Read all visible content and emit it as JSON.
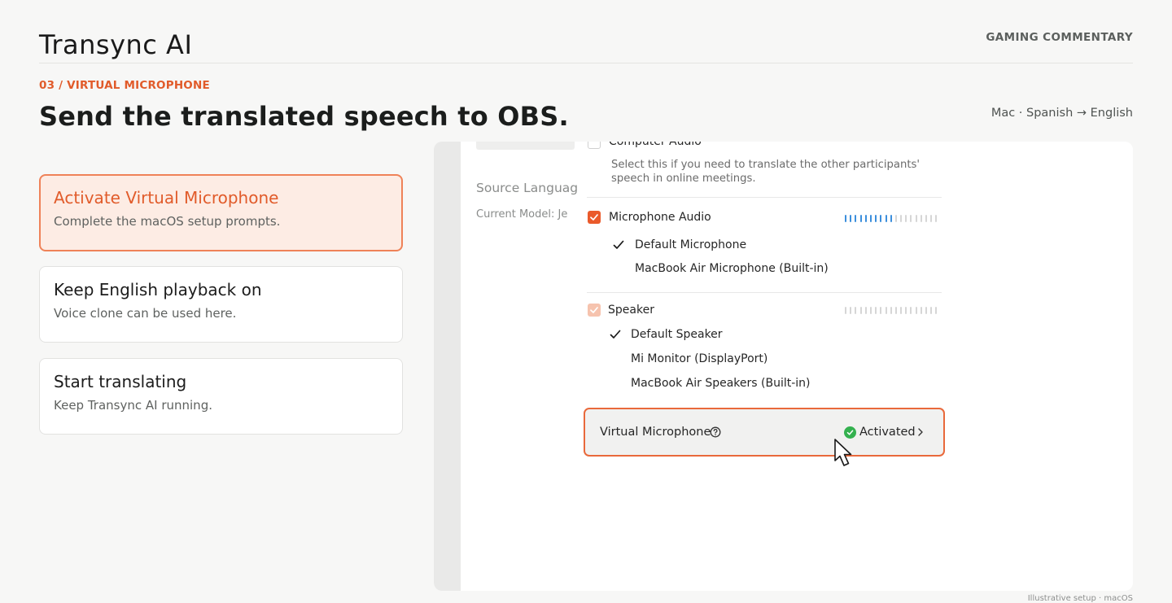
{
  "header": {
    "brand": "Transync AI",
    "category": "GAMING COMMENTARY",
    "step_label": "03 / VIRTUAL MICROPHONE",
    "headline": "Send the translated speech to OBS.",
    "meta": "Mac · Spanish → English"
  },
  "steps": [
    {
      "title": "Activate Virtual Microphone",
      "subtitle": "Complete the macOS setup prompts.",
      "active": true
    },
    {
      "title": "Keep English playback on",
      "subtitle": "Voice clone can be used here.",
      "active": false
    },
    {
      "title": "Start translating",
      "subtitle": "Keep Transync AI running.",
      "active": false
    }
  ],
  "app": {
    "source_language_label": "Source Languag",
    "current_model_label": "Current Model: Je",
    "popup": {
      "computer_audio": {
        "label": "Computer Audio",
        "checked": false,
        "description": "Select this if you need to translate the other participants' speech in online meetings."
      },
      "microphone_audio": {
        "label": "Microphone Audio",
        "checked": true,
        "level_fraction": 0.5,
        "options": [
          "Default Microphone",
          "MacBook Air Microphone (Built-in)"
        ],
        "selected": "Default Microphone"
      },
      "speaker": {
        "label": "Speaker",
        "checked": true,
        "disabled": true,
        "level_fraction": 0,
        "options": [
          "Default Speaker",
          "Mi Monitor (DisplayPort)",
          "MacBook Air Speakers (Built-in)"
        ],
        "selected": "Default Speaker"
      }
    },
    "virtual_microphone": {
      "label": "Virtual Microphone",
      "status": "Activated",
      "status_color": "#34b14f"
    }
  },
  "footnote": "Illustrative setup · macOS",
  "colors": {
    "accent": "#e15b2a",
    "active_card_bg": "#fdece4",
    "meter_on": "#3c8fdc"
  }
}
